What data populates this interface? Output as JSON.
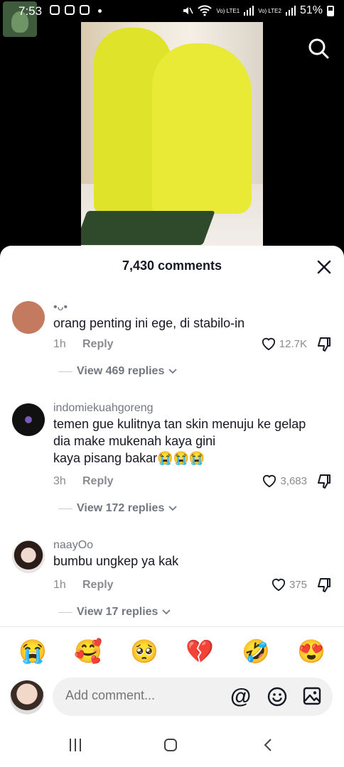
{
  "status": {
    "time": "7:53",
    "battery": "51%",
    "lte1": "Vo) LTE1",
    "lte2": "Vo) LTE2"
  },
  "sheet": {
    "title": "7,430 comments"
  },
  "comments": [
    {
      "username": "•ᴗ•",
      "text": "orang penting ini ege, di stabilo-in",
      "time": "1h",
      "reply_label": "Reply",
      "likes": "12.7K",
      "view_replies": "View 469 replies"
    },
    {
      "username": "indomiekuahgoreng",
      "text": "temen gue kulitnya tan skin menuju ke gelap\ndia make mukenah kaya gini\nkaya pisang bakar😭😭😭",
      "time": "3h",
      "reply_label": "Reply",
      "likes": "3,683",
      "view_replies": "View 172 replies"
    },
    {
      "username": "naayOo",
      "text": "bumbu ungkep ya kak",
      "time": "1h",
      "reply_label": "Reply",
      "likes": "375",
      "view_replies": "View 17 replies"
    }
  ],
  "quick_emojis": [
    "😭",
    "🥰",
    "🥺",
    "💔",
    "🤣",
    "😍"
  ],
  "composer": {
    "placeholder": "Add comment...",
    "at_symbol": "@"
  },
  "colors": {
    "sheet_bg": "#ffffff",
    "text": "#161823",
    "muted": "#8a8b91"
  }
}
